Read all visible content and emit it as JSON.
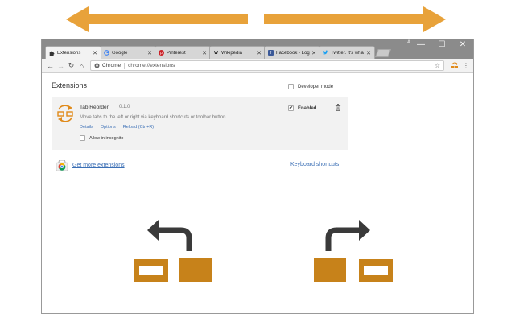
{
  "colors": {
    "accent_orange": "#e8a23a",
    "brand_orange": "#c7821a",
    "dark_arrow": "#3a3a3a",
    "link_blue": "#3b6fb5",
    "titlebar_gray": "#8b8b8b"
  },
  "window": {
    "profile_badge": "A",
    "controls": [
      "—",
      "☐",
      "✕"
    ]
  },
  "tabs": [
    {
      "title": "Extensions",
      "icon": "puzzle-icon",
      "close": "✕",
      "active": true
    },
    {
      "title": "Google",
      "icon": "google-icon",
      "close": "✕",
      "active": false
    },
    {
      "title": "Pinterest",
      "icon": "pinterest-icon",
      "close": "✕",
      "active": false
    },
    {
      "title": "Wikipedia",
      "icon": "wikipedia-icon",
      "close": "✕",
      "active": false
    },
    {
      "title": "Facebook - Log",
      "icon": "facebook-icon",
      "close": "✕",
      "active": false
    },
    {
      "title": "Twitter. It's wha",
      "icon": "twitter-icon",
      "close": "✕",
      "active": false
    }
  ],
  "toolbar": {
    "back": "←",
    "forward": "→",
    "reload": "↻",
    "home": "⌂",
    "site_label": "Chrome",
    "url": "chrome://extensions",
    "star": "☆",
    "menu": "⋮"
  },
  "page": {
    "title": "Extensions",
    "developer_mode_label": "Developer mode",
    "developer_mode_checked": false
  },
  "extension": {
    "name": "Tab Reorder",
    "version": "0.1.0",
    "description": "Move tabs to the left or right via keyboard shortcuts or toolbar button.",
    "links": [
      "Details",
      "Options",
      "Reload (Ctrl+R)"
    ],
    "incognito_label": "Allow in incognito",
    "incognito_checked": false,
    "enabled_label": "Enabled",
    "enabled_checked": true,
    "check_mark": "✔"
  },
  "footer": {
    "get_more_label": "Get more extensions",
    "keyboard_shortcuts_label": "Keyboard shortcuts"
  }
}
